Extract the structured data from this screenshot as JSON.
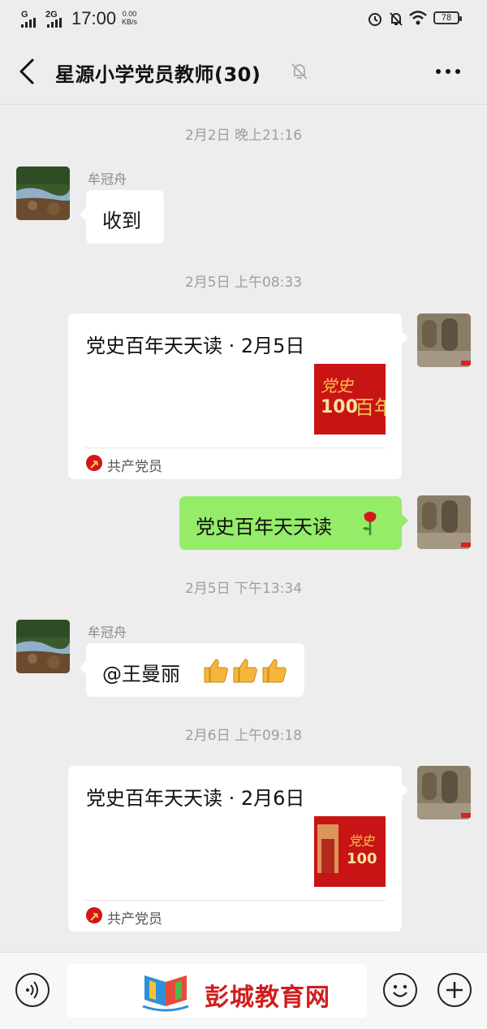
{
  "status_bar": {
    "signal1": "G",
    "signal2": "2G",
    "time": "17:00",
    "net_speed_value": "0.00",
    "net_speed_unit": "KB/s",
    "battery": "78"
  },
  "nav": {
    "title": "星源小学党员教师(30)",
    "back_icon": "chevron-left-icon",
    "mute_icon": "bell-off-icon",
    "more_icon": "more-dots-icon"
  },
  "messages": [
    {
      "type": "timestamp",
      "text": "2月2日 晚上21:16"
    },
    {
      "type": "text",
      "side": "left",
      "sender": "牟冠舟",
      "text": "收到"
    },
    {
      "type": "timestamp",
      "text": "2月5日 上午08:33"
    },
    {
      "type": "card",
      "side": "right",
      "title": "党史百年天天读 · 2月5日",
      "source": "共产党员"
    },
    {
      "type": "text",
      "side": "right",
      "text": "党史百年天天读",
      "emoji": "rose-icon"
    },
    {
      "type": "timestamp",
      "text": "2月5日 下午13:34"
    },
    {
      "type": "text",
      "side": "left",
      "sender": "牟冠舟",
      "text": "@王曼丽",
      "emoji": "thumbs-up-icon x3"
    },
    {
      "type": "timestamp",
      "text": "2月6日 上午09:18"
    },
    {
      "type": "card",
      "side": "right",
      "title": "党史百年天天读 · 2月6日",
      "source": "共产党员"
    }
  ],
  "input_bar": {
    "voice_icon": "voice-icon",
    "emoji_icon": "smiley-icon",
    "plus_icon": "plus-icon",
    "watermark": "彭城教育网"
  },
  "colors": {
    "background": "#ededed",
    "sent_bubble": "#95ec69",
    "received_bubble": "#ffffff",
    "party_red": "#d4151b"
  }
}
